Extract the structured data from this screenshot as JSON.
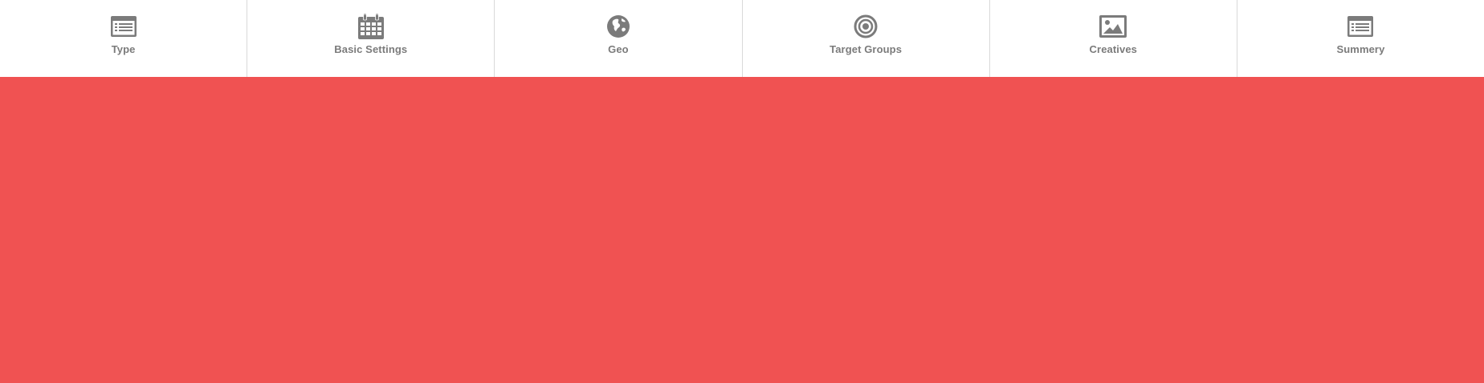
{
  "wizard": {
    "steps": [
      {
        "label": "Type",
        "icon": "list-card-icon"
      },
      {
        "label": "Basic Settings",
        "icon": "calendar-icon"
      },
      {
        "label": "Geo",
        "icon": "globe-icon"
      },
      {
        "label": "Target Groups",
        "icon": "target-icon"
      },
      {
        "label": "Creatives",
        "icon": "image-icon"
      },
      {
        "label": "Summery",
        "icon": "list-card-icon"
      }
    ]
  },
  "colors": {
    "icon": "#7b7b7b",
    "label": "#7b7b7b",
    "divider": "#d9d9d9",
    "content_background": "#f05252"
  }
}
